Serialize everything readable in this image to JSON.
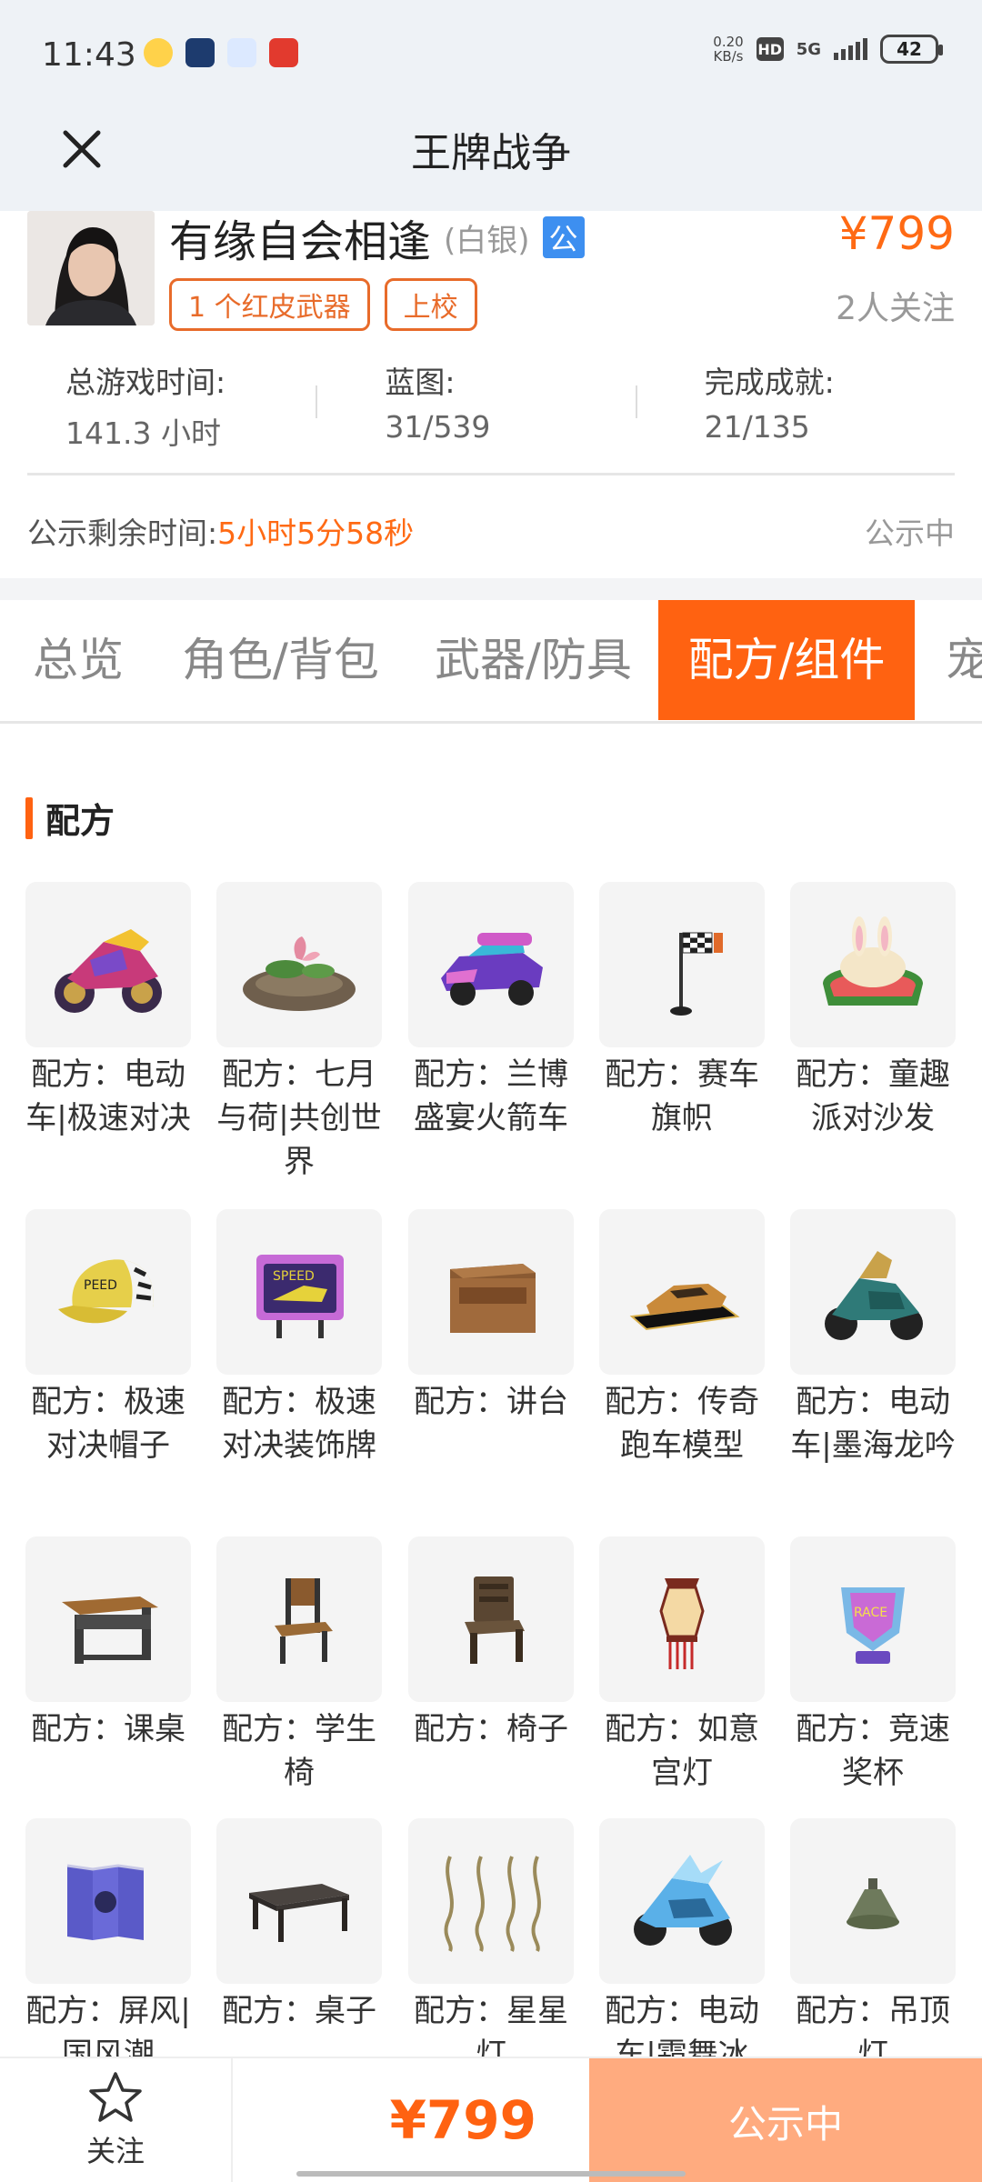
{
  "status_bar": {
    "time": "11:43",
    "net_speed_value": "0.20",
    "net_speed_unit": "KB/s",
    "hd": "HD",
    "network": "5G",
    "battery": "42"
  },
  "header": {
    "title": "王牌战争"
  },
  "profile": {
    "name": "有缘自会相逢",
    "rank_tag": "(白银)",
    "public_badge": "公",
    "price": "¥799",
    "badges": [
      "1 个红皮武器",
      "上校"
    ],
    "followers": "2人关注"
  },
  "stats": [
    {
      "label": "总游戏时间:",
      "value": "141.3 小时"
    },
    {
      "label": "蓝图:",
      "value": "31/539"
    },
    {
      "label": "完成成就:",
      "value": "21/135"
    }
  ],
  "notice": {
    "label": "公示剩余时间:",
    "time": "5小时5分58秒",
    "status": "公示中"
  },
  "tabs": [
    {
      "label": "总览",
      "active": false
    },
    {
      "label": "角色/背包",
      "active": false
    },
    {
      "label": "武器/防具",
      "active": false
    },
    {
      "label": "配方/组件",
      "active": true
    },
    {
      "label": "宠",
      "active": false
    }
  ],
  "section": {
    "title": "配方"
  },
  "items": [
    {
      "name": "配方：电动车|极速对决",
      "icon": "motorbike-icon"
    },
    {
      "name": "配方：七月与荷|共创世界",
      "icon": "lotus-icon"
    },
    {
      "name": "配方：兰博盛宴火箭车",
      "icon": "rocket-car-icon"
    },
    {
      "name": "配方：赛车旗帜",
      "icon": "race-flag-icon"
    },
    {
      "name": "配方：童趣派对沙发",
      "icon": "bunny-sofa-icon"
    },
    {
      "name": "配方：极速对决帽子",
      "icon": "cap-icon"
    },
    {
      "name": "配方：极速对决装饰牌",
      "icon": "sign-board-icon"
    },
    {
      "name": "配方：讲台",
      "icon": "podium-icon"
    },
    {
      "name": "配方：传奇跑车模型",
      "icon": "car-model-icon"
    },
    {
      "name": "配方：电动车|墨海龙吟",
      "icon": "dragon-scooter-icon"
    },
    {
      "name": "配方：课桌",
      "icon": "school-desk-icon"
    },
    {
      "name": "配方：学生椅",
      "icon": "student-chair-icon"
    },
    {
      "name": "配方：椅子",
      "icon": "chair-icon"
    },
    {
      "name": "配方：如意宫灯",
      "icon": "lantern-icon"
    },
    {
      "name": "配方：竞速奖杯",
      "icon": "trophy-icon"
    },
    {
      "name": "配方：屏风|国风潮",
      "icon": "folding-screen-icon"
    },
    {
      "name": "配方：桌子",
      "icon": "table-icon"
    },
    {
      "name": "配方：星星灯",
      "icon": "string-lights-icon"
    },
    {
      "name": "配方：电动车|霜舞冰",
      "icon": "ice-scooter-icon"
    },
    {
      "name": "配方：吊顶灯",
      "icon": "ceiling-lamp-icon"
    }
  ],
  "bottom_bar": {
    "follow_label": "关注",
    "price": "¥799",
    "button_label": "公示中"
  },
  "colors": {
    "accent": "#ff6211",
    "price": "#ff6a14",
    "button_disabled": "#ffab7f",
    "badge_border": "#e86b2a",
    "public_badge": "#3d8ff0"
  }
}
